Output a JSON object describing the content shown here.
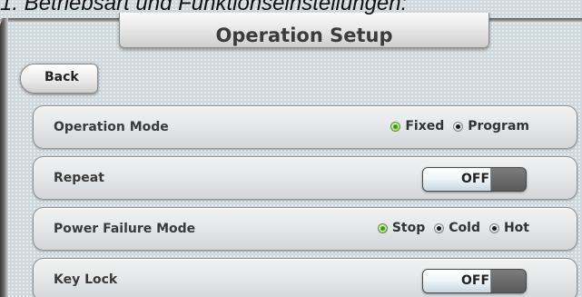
{
  "caption": "1. Betriebsart und Funktionseinstellungen:",
  "title": "Operation Setup",
  "back_label": "Back",
  "rows": [
    {
      "label": "Operation Mode",
      "options": [
        "Fixed",
        "Program"
      ],
      "selected": "Fixed"
    },
    {
      "label": "Repeat",
      "toggle_value": "OFF"
    },
    {
      "label": "Power Failure Mode",
      "options": [
        "Stop",
        "Cold",
        "Hot"
      ],
      "selected": "Stop"
    },
    {
      "label": "Key Lock",
      "toggle_value": "OFF"
    }
  ],
  "colors": {
    "selected_radio": "#3f9b12",
    "unselected_radio": "#1b1b1b",
    "background": "#cfd8dd"
  }
}
